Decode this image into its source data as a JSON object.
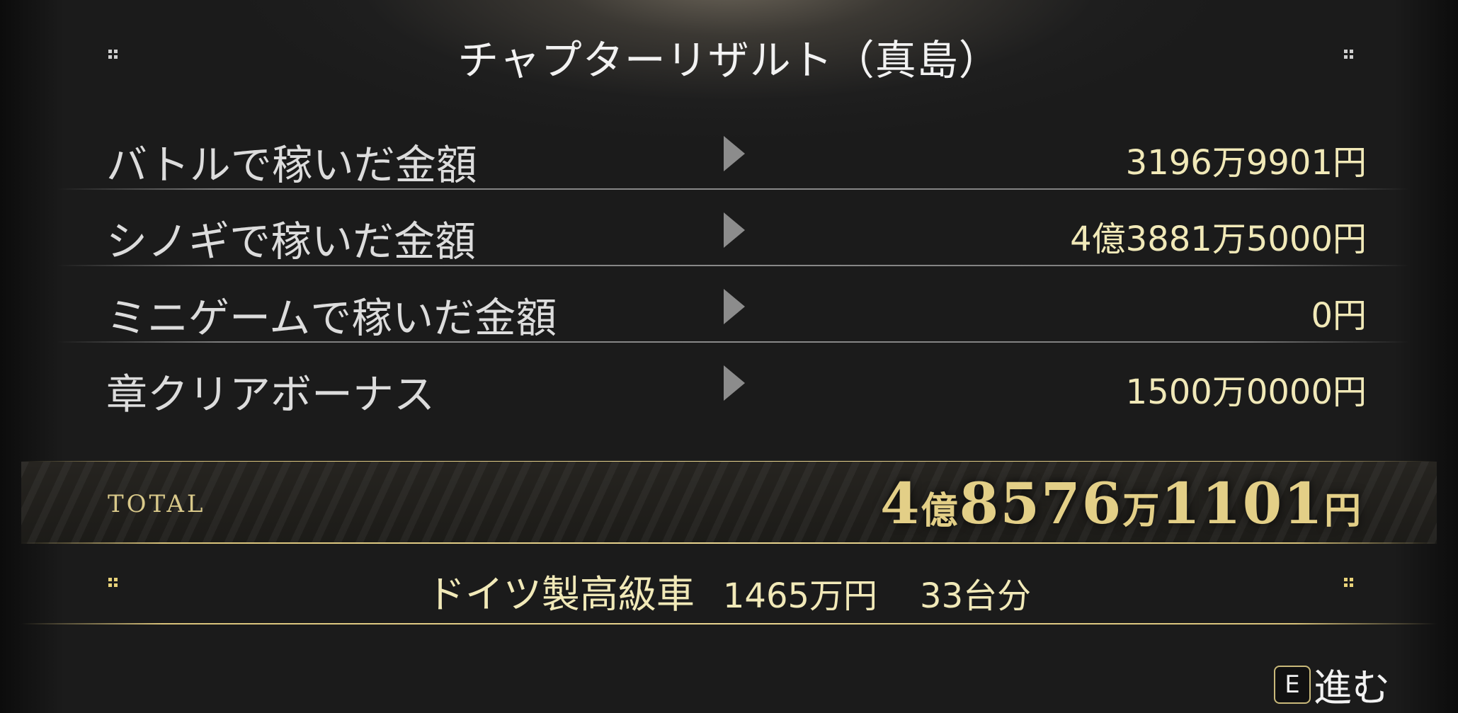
{
  "title": "チャプターリザルト（真島）",
  "rows": [
    {
      "label": "バトルで稼いだ金額",
      "value": "3196万9901円"
    },
    {
      "label": "シノギで稼いだ金額",
      "value": "4億3881万5000円"
    },
    {
      "label": "ミニゲームで稼いだ金額",
      "value": "0円"
    },
    {
      "label": "章クリアボーナス",
      "value": "1500万0000円"
    }
  ],
  "total": {
    "label": "TOTAL",
    "oku": "4",
    "oku_unit": "億",
    "man": "8576",
    "man_unit": "万",
    "rest": "1101",
    "yen_unit": "円"
  },
  "comparison": {
    "item": "ドイツ製高級車",
    "price": "1465万円",
    "count": "33台分"
  },
  "continue": {
    "key": "E",
    "label": "進む"
  },
  "colors": {
    "value_text": "#f1e9b8",
    "gold_accent": "#e3cf87",
    "label_text": "#dcdcdc",
    "background": "#1b1b1b"
  }
}
